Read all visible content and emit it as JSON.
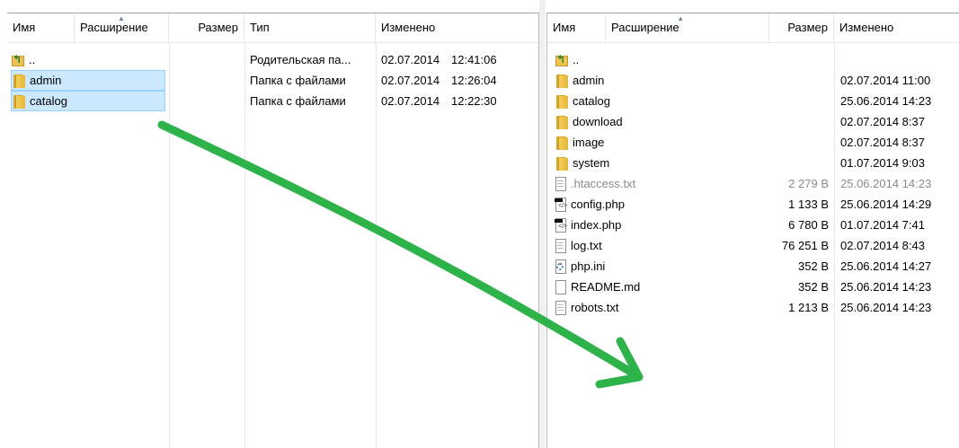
{
  "left_panel": {
    "columns": {
      "name": "Имя",
      "extension": "Расширение",
      "size": "Размер",
      "type": "Тип",
      "modified": "Изменено"
    },
    "rows": [
      {
        "icon": "parent-folder-icon",
        "name": "..",
        "type": "Родительская па...",
        "date": "02.07.2014",
        "time": "12:41:06",
        "selected": false
      },
      {
        "icon": "folder-icon",
        "name": "admin",
        "type": "Папка с файлами",
        "date": "02.07.2014",
        "time": "12:26:04",
        "selected": true
      },
      {
        "icon": "folder-icon",
        "name": "catalog",
        "type": "Папка с файлами",
        "date": "02.07.2014",
        "time": "12:22:30",
        "selected": true
      }
    ]
  },
  "right_panel": {
    "columns": {
      "name": "Имя",
      "extension": "Расширение",
      "size": "Размер",
      "modified": "Изменено"
    },
    "rows": [
      {
        "icon": "parent-folder-icon",
        "name": "..",
        "size": "",
        "modified": ""
      },
      {
        "icon": "folder-icon",
        "name": "admin",
        "size": "",
        "modified": "02.07.2014 11:00"
      },
      {
        "icon": "folder-icon",
        "name": "catalog",
        "size": "",
        "modified": "25.06.2014 14:23"
      },
      {
        "icon": "folder-icon",
        "name": "download",
        "size": "",
        "modified": "02.07.2014 8:37"
      },
      {
        "icon": "folder-icon",
        "name": "image",
        "size": "",
        "modified": "02.07.2014 8:37"
      },
      {
        "icon": "folder-icon",
        "name": "system",
        "size": "",
        "modified": "01.07.2014 9:03"
      },
      {
        "icon": "text-file-icon",
        "name": ".htaccess.txt",
        "size": "2 279 B",
        "modified": "25.06.2014 14:23",
        "dim": true
      },
      {
        "icon": "php-file-icon",
        "name": "config.php",
        "size": "1 133 B",
        "modified": "25.06.2014 14:29"
      },
      {
        "icon": "php-file-icon",
        "name": "index.php",
        "size": "6 780 B",
        "modified": "01.07.2014 7:41"
      },
      {
        "icon": "text-file-icon",
        "name": "log.txt",
        "size": "76 251 B",
        "modified": "02.07.2014 8:43"
      },
      {
        "icon": "ini-file-icon",
        "name": "php.ini",
        "size": "352 B",
        "modified": "25.06.2014 14:27"
      },
      {
        "icon": "file-icon",
        "name": "README.md",
        "size": "352 B",
        "modified": "25.06.2014 14:23"
      },
      {
        "icon": "text-file-icon",
        "name": "robots.txt",
        "size": "1 213 B",
        "modified": "25.06.2014 14:23"
      }
    ]
  },
  "annotation": {
    "icon": "green-arrow-icon",
    "color": "#2eb24a"
  },
  "colors": {
    "selection_bg": "#cce8ff",
    "selection_border": "#99d1ff",
    "folder": "#f4cf5a",
    "sort_arrow": "#6d86a6"
  }
}
